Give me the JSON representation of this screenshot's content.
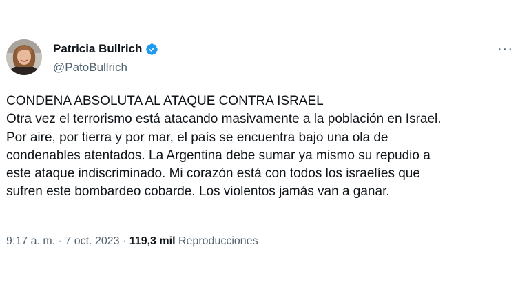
{
  "author": {
    "display_name": "Patricia Bullrich",
    "handle": "@PatoBullrich",
    "verified_icon": "verified-badge-icon",
    "verified_color": "#1d9bf0"
  },
  "more_menu": {
    "icon": "more-horizontal-icon",
    "label": "···"
  },
  "tweet": {
    "lines": [
      "CONDENA ABSOLUTA AL ATAQUE CONTRA ISRAEL",
      "Otra vez el terrorismo está atacando masivamente a la población en Israel.",
      "Por aire, por tierra y por mar, el país se encuentra bajo una ola de",
      "condenables atentados. La Argentina debe sumar ya mismo su repudio a",
      "este ataque indiscriminado. Mi corazón está con todos los israelíes que",
      "sufren este bombardeo cobarde. Los violentos jamás van a ganar."
    ]
  },
  "meta": {
    "time": "9:17 a. m.",
    "separator": "·",
    "date": "7 oct. 2023",
    "views_count": "119,3 mil",
    "views_label": "Reproducciones"
  },
  "colors": {
    "text": "#0f1419",
    "secondary": "#536471",
    "background": "#ffffff"
  }
}
